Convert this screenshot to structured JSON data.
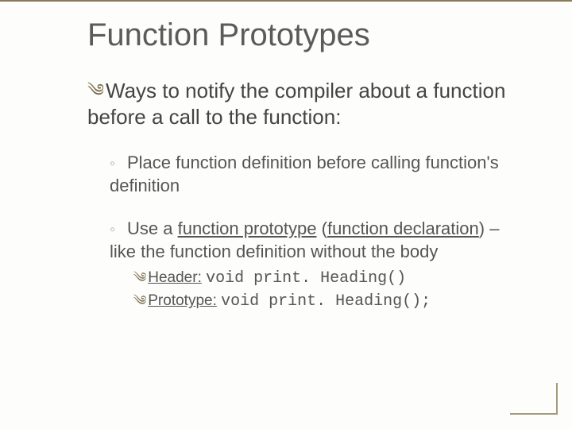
{
  "title": "Function Prototypes",
  "lvl1_text": "Ways to notify the compiler about a function before a call to the function:",
  "lvl2a": "Place function definition before calling function's definition",
  "lvl2b_pre": "Use a ",
  "lvl2b_u1": "function prototype",
  "lvl2b_mid": " (",
  "lvl2b_u2": "function declaration",
  "lvl2b_post": ") – like the function definition without the body",
  "lvl3a_label": "Header:",
  "lvl3a_code": "void print. Heading()",
  "lvl3b_label": "Prototype:",
  "lvl3b_code": "void print. Heading();",
  "bullets": {
    "swirl": "༄",
    "ring": "◦"
  }
}
